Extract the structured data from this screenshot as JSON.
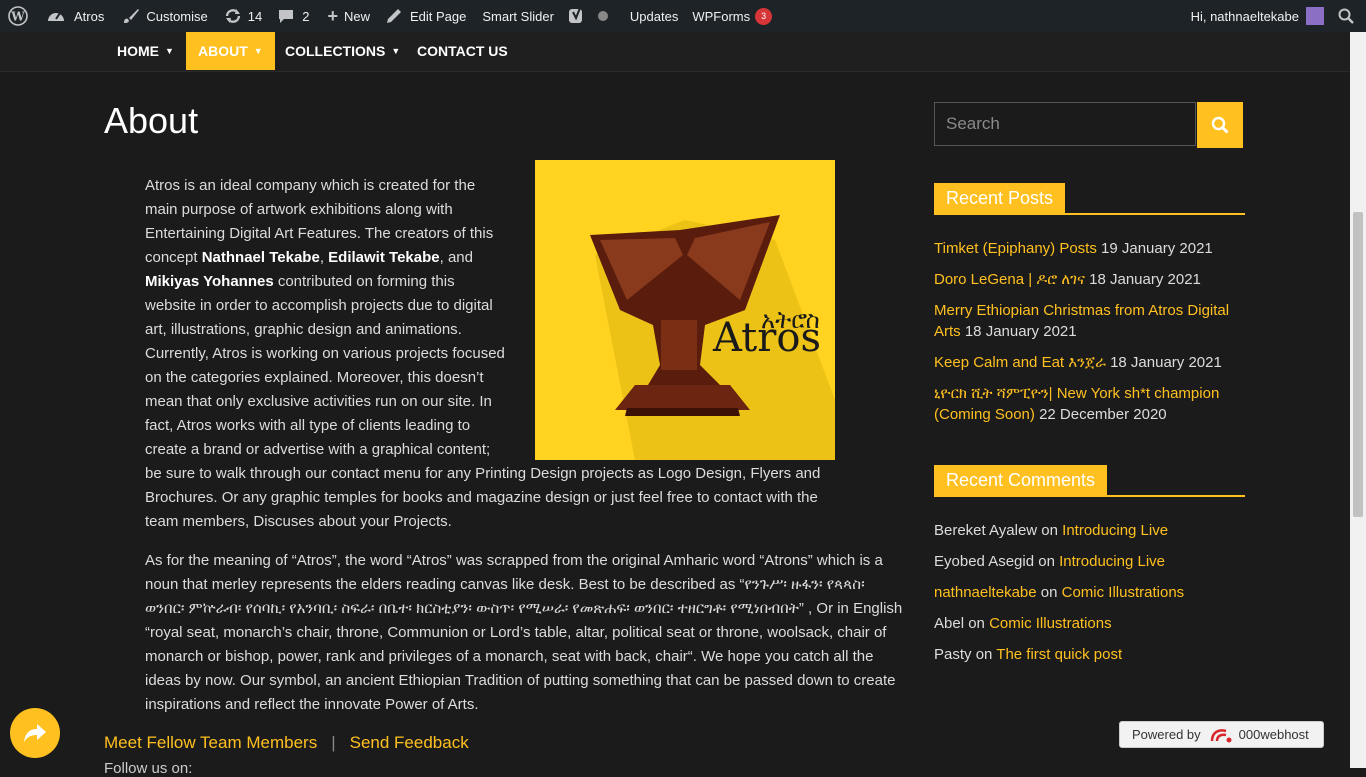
{
  "adminbar": {
    "site_name": "Atros",
    "customise": "Customise",
    "updates_count": "14",
    "comments_count": "2",
    "new_label": "New",
    "edit_page": "Edit Page",
    "smart_slider": "Smart Slider",
    "updates": "Updates",
    "wpforms": "WPForms",
    "wpforms_badge": "3",
    "greeting": "Hi, nathnaeltekabe"
  },
  "nav": {
    "items": [
      {
        "label": "HOME"
      },
      {
        "label": "ABOUT"
      },
      {
        "label": "COLLECTIONS"
      },
      {
        "label": "CONTACT US"
      }
    ]
  },
  "page": {
    "title": "About",
    "logo_text_latin": "Atros",
    "logo_text_amharic": "አትሮስ",
    "p1": {
      "t1": "Atros is an ideal company which is created for the main purpose of artwork exhibitions along with Entertaining Digital Art Features. The creators of this concept ",
      "b1": "Nathnael Tekabe",
      "t2": ", ",
      "b2": "Edilawit Tekabe",
      "t3": ", and ",
      "b3": "Mikiyas Yohannes",
      "t4": " contributed on forming this website in order to accomplish projects due to digital art, illustrations, graphic design and animations. Currently, Atros is working on various projects focused on the categories explained. Moreover, this doesn’t mean that only exclusive activities run on our site. In fact, Atros works with all type of clients leading to create a brand or advertise with a graphical content; be sure to walk through our contact menu for any Printing Design projects as Logo Design, Flyers and Brochures. Or any graphic temples for books and magazine design or just feel free to contact with the team members, Discuses about your Projects."
    },
    "p2": "As for the meaning of “Atros”, the word “Atros” was scrapped from the original Amharic word “Atrons” which is a noun that merley represents the elders reading canvas like desk. Best to be described as “የንጉሥ፡ ዙፋን፡ የጳጳስ፡ ወንበር፡ ምኵራብ፡ የሰባኪ፡ የአንባቢ፡ ስፍራ፡ በቤተ፡ ክርስቲያን፡ ውስጥ፡ የሚሠራ፡ የመጽሐፍ፡ ወንበር፡ ተዘርግቶ፡ የሚነበብበት” , Or in English “royal seat, monarch’s chair, throne, Communion or Lord’s table, altar, political seat or throne, woolsack, chair of monarch or bishop, power, rank and privileges of a monarch, seat with back, chair“. We hope you catch all the ideas by now. Our symbol, an ancient Ethiopian Tradition of putting something that can be passed down to create inspirations and reflect the innovate Power of Arts.",
    "link_team": "Meet Fellow Team Members",
    "link_sep": "|",
    "link_feedback": "Send Feedback",
    "follow": "Follow us on:"
  },
  "sidebar": {
    "search_placeholder": "Search",
    "recent_posts_title": "Recent Posts",
    "recent_posts": [
      {
        "title": "Timket (Epiphany) Posts",
        "date": "19 January 2021"
      },
      {
        "title": "Doro LeGena | ዶሮ ለገና",
        "date": "18 January 2021"
      },
      {
        "title": "Merry Ethiopian Christmas from Atros Digital Arts",
        "date": "18 January 2021"
      },
      {
        "title": "Keep Calm and Eat እንጀራ",
        "date": "18 January 2021"
      },
      {
        "title": "ኒዮርክ ሺት ሻምፒዮን| New York sh*t champion (Coming Soon)",
        "date": "22 December 2020"
      }
    ],
    "recent_comments_title": "Recent Comments",
    "recent_comments": [
      {
        "author": "Bereket Ayalew",
        "on": "on",
        "post": "Introducing Live",
        "author_link": false
      },
      {
        "author": "Eyobed Asegid",
        "on": "on",
        "post": "Introducing Live",
        "author_link": false
      },
      {
        "author": "nathnaeltekabe",
        "on": "on",
        "post": "Comic Illustrations",
        "author_link": true
      },
      {
        "author": "Abel",
        "on": "on",
        "post": "Comic Illustrations",
        "author_link": false
      },
      {
        "author": "Pasty",
        "on": "on",
        "post": "The first quick post",
        "author_link": false
      }
    ]
  },
  "powered": {
    "label": "Powered by",
    "brand": "000webhost"
  },
  "colors": {
    "accent": "#ffc020",
    "background": "#1b1b1b",
    "adminbar": "#1d2327"
  }
}
